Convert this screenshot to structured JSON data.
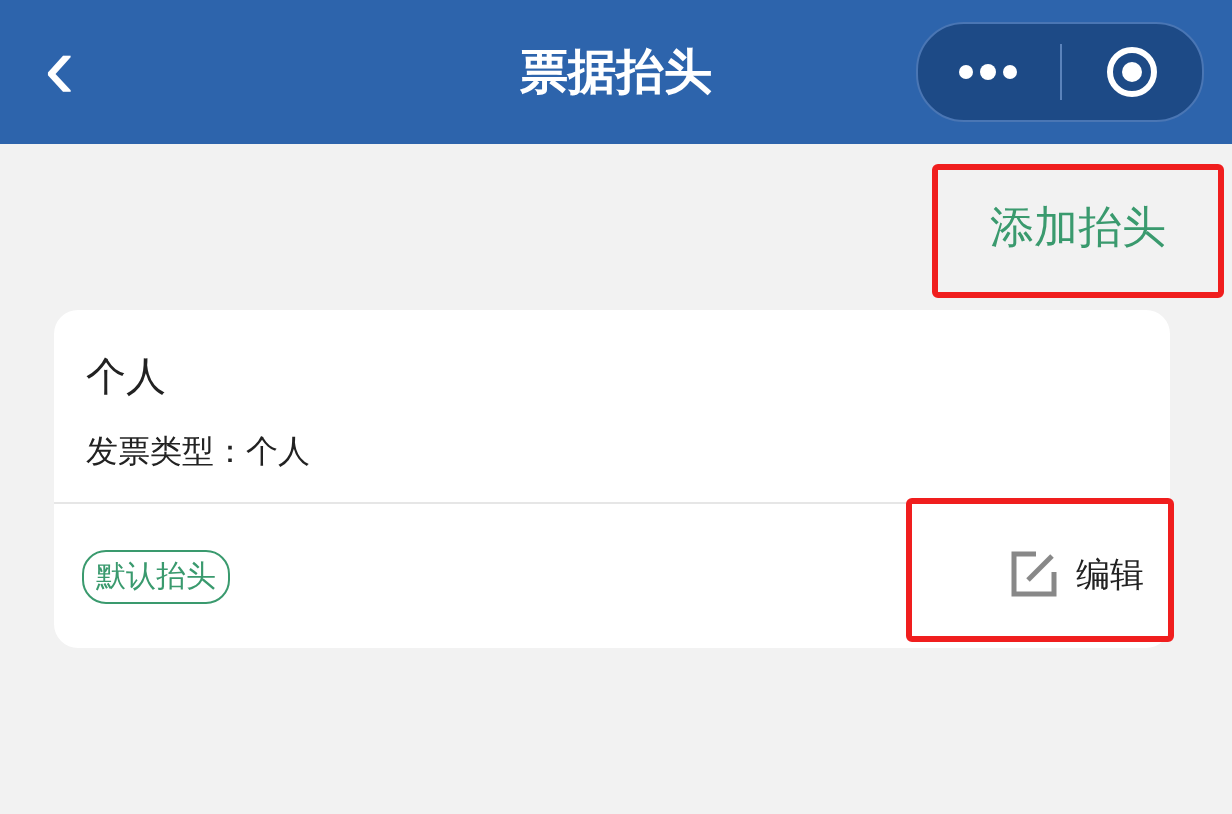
{
  "header": {
    "back": "‹",
    "title": "票据抬头"
  },
  "add_button": {
    "label": "添加抬头",
    "highlighted": true
  },
  "cards": [
    {
      "name": "个人",
      "detail": "发票类型：个人",
      "tag": "默认抬头",
      "is_default": true,
      "edit": {
        "label": "编辑",
        "highlighted": true
      }
    }
  ]
}
